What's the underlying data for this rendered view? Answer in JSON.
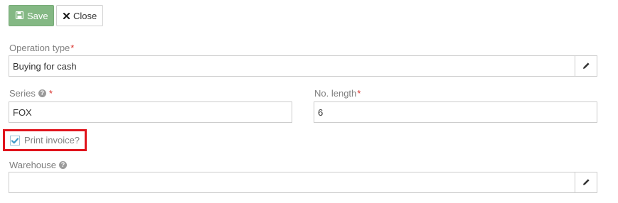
{
  "toolbar": {
    "save_label": "Save",
    "close_label": "Close"
  },
  "form": {
    "operation_type": {
      "label": "Operation type",
      "required": "*",
      "value": "Buying for cash",
      "edit_icon": "pencil-icon"
    },
    "series": {
      "label": "Series",
      "required": "*",
      "help_icon": "question-circle-icon",
      "value": "FOX"
    },
    "no_length": {
      "label": "No. length",
      "required": "*",
      "value": "6"
    },
    "print_invoice": {
      "label": "Print invoice?",
      "checked": true
    },
    "warehouse": {
      "label": "Warehouse",
      "help_icon": "question-circle-icon",
      "value": "",
      "edit_icon": "pencil-icon"
    }
  },
  "colors": {
    "save_button": "#84b884",
    "required_marker": "#d9322c",
    "highlight_box": "#e0141c",
    "checkbox_check": "#3d9ac8"
  }
}
